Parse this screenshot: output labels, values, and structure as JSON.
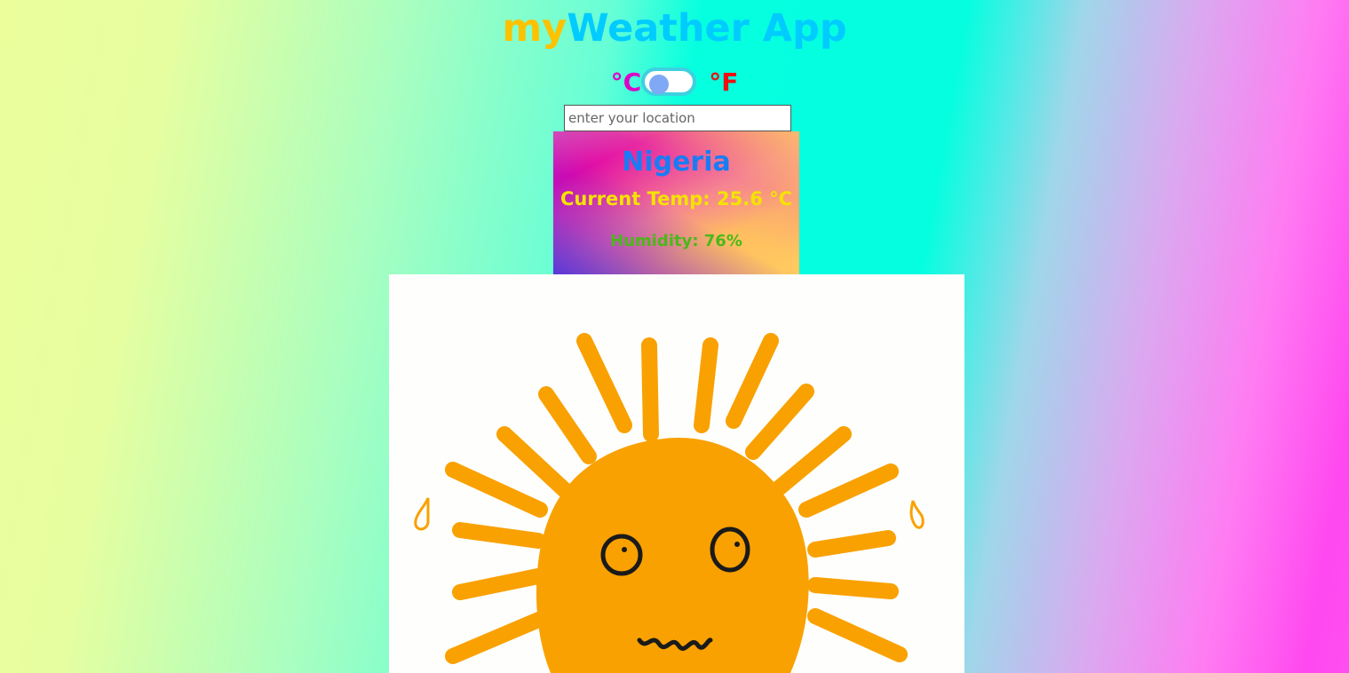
{
  "app": {
    "title_prefix": "my",
    "title_rest": "Weather App"
  },
  "units": {
    "celsius_label": "°C",
    "fahrenheit_label": "°F",
    "selected": "celsius"
  },
  "search": {
    "placeholder": "enter your location",
    "value": ""
  },
  "weather": {
    "location": "Nigeria",
    "temp_label": "Current Temp: 25.6 °C",
    "humidity_label": "Humidity: 76%"
  },
  "image": {
    "icon": "sweating-sun-icon"
  },
  "colors": {
    "title_prefix": "#fcc200",
    "title_rest": "#00ccff",
    "celsius": "#dd00c8",
    "fahrenheit": "#ee1010",
    "location": "#1a7cf5",
    "temp": "#f4e300",
    "humidity": "#4ab81a",
    "sun": "#f9a100"
  }
}
